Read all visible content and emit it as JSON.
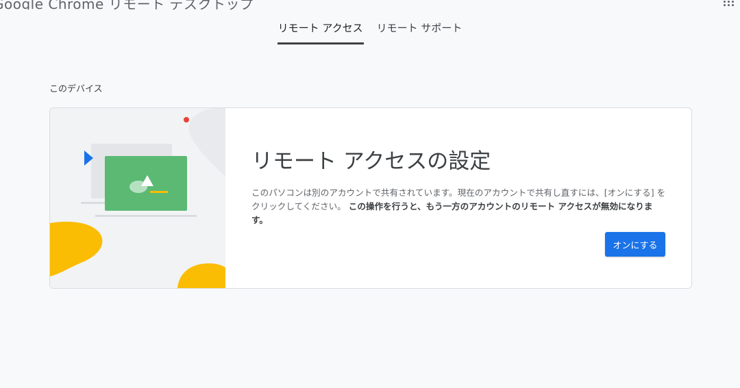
{
  "header": {
    "app_title": "Google Chrome リモート デスクトップ"
  },
  "tabs": [
    {
      "label": "リモート アクセス",
      "active": true
    },
    {
      "label": "リモート サポート",
      "active": false
    }
  ],
  "section": {
    "label": "このデバイス"
  },
  "card": {
    "title": "リモート アクセスの設定",
    "description_plain": "このパソコンは別のアカウントで共有されています。現在のアカウントで共有し直すには、[オンにする] をクリックしてください。 ",
    "description_bold": "この操作を行うと、もう一方のアカウントのリモート アクセスが無効になります。",
    "button_label": "オンにする"
  },
  "colors": {
    "accent": "#1a73e8",
    "screen_green": "#5bb974",
    "yellow": "#fbbc04",
    "red_dot": "#ea4335",
    "play_blue": "#1a73e8"
  },
  "icons": {
    "apps": "apps-grid-icon",
    "play": "play-triangle-icon"
  }
}
